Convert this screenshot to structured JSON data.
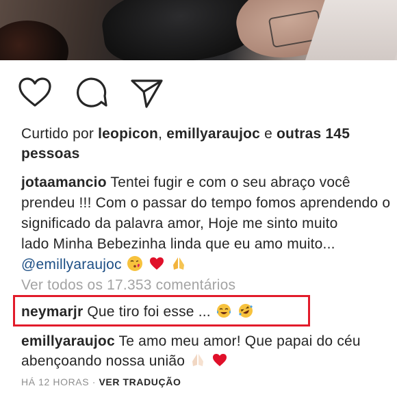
{
  "post": {
    "likes": {
      "prefix": "Curtido por",
      "user1": "leopicon",
      "sep": ",",
      "user2": "emillyaraujoc",
      "conj": "e",
      "others": "outras 145",
      "others_cont": "pessoas"
    },
    "caption": {
      "username": "jotaamancio",
      "line1": "Tentei fugir e com o seu abraço você",
      "line2": "prendeu !!! Com o passar do tempo fomos aprendendo o",
      "line3": "significado da palavra amor, Hoje me sinto muito",
      "line4": "lado Minha Bebezinha linda que eu amo muito...",
      "mention": "@emillyaraujoc"
    },
    "view_all_comments": "Ver todos os 17.353 comentários",
    "comments": [
      {
        "username": "neymarjr",
        "text": "Que tiro foi esse ..."
      },
      {
        "username": "emillyaraujoc",
        "text": "Te amo meu amor! Que papai do céu",
        "text2": "abençoando nossa união"
      }
    ],
    "timestamp": "HÁ 12 HORAS",
    "separator": "·",
    "translate": "VER TRADUÇÃO"
  },
  "icons": [
    "heart-icon",
    "comment-icon",
    "share-icon"
  ],
  "colors": {
    "mention": "#1d4f85",
    "highlight_box": "#e21b2a",
    "muted": "#a3a3a3"
  }
}
